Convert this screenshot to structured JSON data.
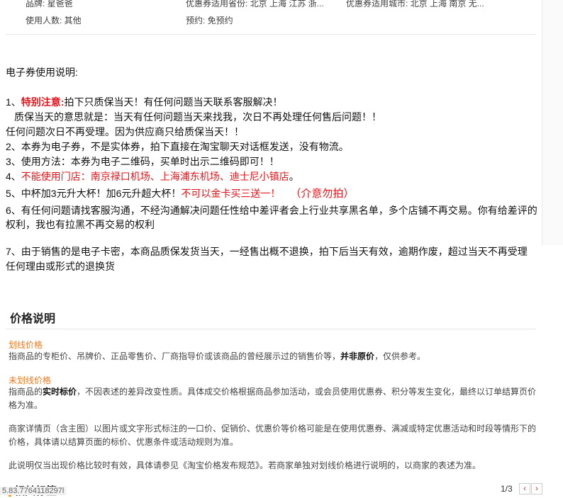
{
  "attributes": {
    "row1": {
      "brand": "品牌: 星爸爸",
      "province": "优惠券适用省份: 北京 上海 江苏 浙...",
      "city": "优惠券适用城市: 北京 上海 南京 无..."
    },
    "row2": {
      "people": "使用人数: 其他",
      "booking": "预约: 免预约"
    }
  },
  "description": {
    "heading": "电子券使用说明:",
    "item1_prefix": "1、",
    "item1_label": "特别注意:",
    "item1_text": "拍下只质保当天！有任何问题当天联系客服解决！",
    "item1_line2": "质保当天的意思就是：当天有任何问题当天来找我，次日不再处理任何售后问题！！",
    "item1_line3": "任何问题次日不再受理。因为供应商只给质保当天！！",
    "item2": "2、本券为电子券，不是实体券，拍下直接在淘宝聊天对话框发送，没有物流。",
    "item3": "3、使用方法：本券为电子二维码，买单时出示二维码即可！！",
    "item4_prefix": "4、",
    "item4_text": "不能使用门店：南京禄口机场、上海浦东机场、迪士尼小镇店",
    "item4_suffix": "。",
    "item5_text": "5、中杯加3元升大杯！加6元升超大杯！",
    "item5_red": "不可以金卡买三送一！",
    "item5_note": "（介意勿拍）",
    "item6_line1": "6、有任何问题请找客服沟通，不经沟通解决问题任性给中差评者会上行业共享黑名单，多个店铺不再交易。你有给差评的",
    "item6_line2": "权利，我也有拉黑不再交易的权利",
    "item7_line1": "7、由于销售的是电子卡密，本商品质保发货当天，一经售出概不退换，拍下后当天有效，逾期作废，超过当天不再受理",
    "item7_line2": "任何理由或形式的退换货"
  },
  "price": {
    "title": "价格说明",
    "strike_label": "划线价格",
    "strike_text_a": "指商品的专柜价、吊牌价、正品零售价、厂商指导价或该商品的曾经展示过的销售价等，",
    "strike_text_bold": "并非原价",
    "strike_text_b": "，仅供参考。",
    "unstrike_label": "未划线价格",
    "unstrike_text_a": "指商品的",
    "unstrike_text_bold": "实时标价",
    "unstrike_text_b": "，不因表述的差异改变性质。具体成交价格根据商品参加活动，或会员使用优惠券、积分等发生变化，最终以订单结算页价格为准。",
    "merchant_text": "商家详情页（含主图）以图片或文字形式标注的一口价、促销价、优惠价等价格可能是在使用优惠券、满减或特定优惠活动和时段等情形下的价格，具体请以结算页面的标价、优惠条件或活动规则为准。",
    "note_text": "此说明仅当出现价格比较时有效，具体请参见《淘宝价格发布规范》。若商家单独对划线价格进行说明的，以商家的表述为准。"
  },
  "next_section": "相关标签",
  "url_fragment": "5.83.7764118297l",
  "pager": {
    "text": "1/3",
    "prev": "‹",
    "next": "›"
  }
}
